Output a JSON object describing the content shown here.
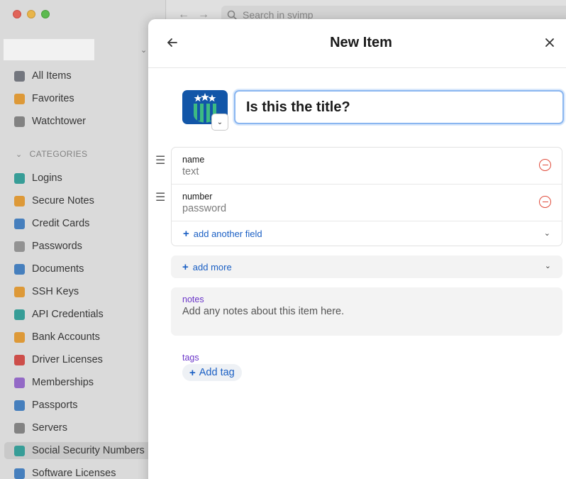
{
  "window": {
    "search_placeholder": "Search in svimp"
  },
  "sidebar": {
    "items_top": [
      {
        "label": "All Items",
        "icon": "all-items-icon",
        "color": "#7a7d85"
      },
      {
        "label": "Favorites",
        "icon": "star-icon",
        "color": "#e9a23b"
      },
      {
        "label": "Watchtower",
        "icon": "watchtower-icon",
        "color": "#8a8a8a"
      }
    ],
    "categories_header": "CATEGORIES",
    "categories": [
      {
        "label": "Logins",
        "icon": "key-icon",
        "color": "#3aa6a0"
      },
      {
        "label": "Secure Notes",
        "icon": "note-icon",
        "color": "#e9a23b"
      },
      {
        "label": "Credit Cards",
        "icon": "credit-card-icon",
        "color": "#4a86c8"
      },
      {
        "label": "Passwords",
        "icon": "password-key-icon",
        "color": "#9a9a9a"
      },
      {
        "label": "Documents",
        "icon": "document-icon",
        "color": "#4a86c8"
      },
      {
        "label": "SSH Keys",
        "icon": "terminal-icon",
        "color": "#e9a23b"
      },
      {
        "label": "API Credentials",
        "icon": "code-icon",
        "color": "#3aa6a0"
      },
      {
        "label": "Bank Accounts",
        "icon": "bank-icon",
        "color": "#e9a23b"
      },
      {
        "label": "Driver Licenses",
        "icon": "car-icon",
        "color": "#d9534f"
      },
      {
        "label": "Memberships",
        "icon": "membership-icon",
        "color": "#9b6fd1"
      },
      {
        "label": "Passports",
        "icon": "globe-icon",
        "color": "#4a86c8"
      },
      {
        "label": "Servers",
        "icon": "server-icon",
        "color": "#8a8a8a"
      },
      {
        "label": "Social Security Numbers",
        "icon": "ssn-icon",
        "color": "#3aa6a0"
      },
      {
        "label": "Software Licenses",
        "icon": "license-icon",
        "color": "#4a86c8"
      }
    ]
  },
  "modal": {
    "title": "New Item",
    "item_title_value": "Is this the title?",
    "fields": [
      {
        "label": "name",
        "value": "text"
      },
      {
        "label": "number",
        "value": "password"
      }
    ],
    "add_field_label": "add another field",
    "add_more_label": "add more",
    "notes_label": "notes",
    "notes_placeholder": "Add any notes about this item here.",
    "tags_label": "tags",
    "add_tag_label": "Add tag"
  },
  "colors": {
    "accent_blue": "#1a5fc4",
    "section_label_purple": "#6b36c9",
    "remove_red": "#e04a3a",
    "icon_blue": "#1256a8",
    "icon_green": "#3dbb82"
  }
}
